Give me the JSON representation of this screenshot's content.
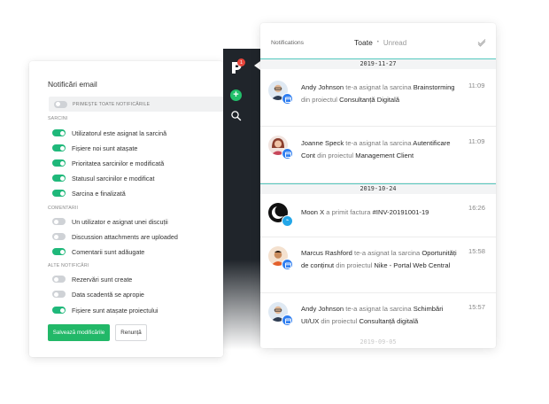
{
  "email_settings": {
    "title": "Notificări email",
    "master_toggle_label": "PRIMEȘTE TOATE NOTIFICĂRILE",
    "sections": [
      {
        "label": "SARCINI",
        "items": [
          {
            "label": "Utilizatorul este asignat la sarcină",
            "on": true
          },
          {
            "label": "Fișiere noi sunt atașate",
            "on": true
          },
          {
            "label": "Prioritatea sarcinilor e modificată",
            "on": true
          },
          {
            "label": "Statusul sarcinilor e modificat",
            "on": true
          },
          {
            "label": "Sarcina e finalizată",
            "on": true
          }
        ]
      },
      {
        "label": "COMENTARII",
        "items": [
          {
            "label": "Un utilizator e asignat unei discuții",
            "on": false
          },
          {
            "label": "Discussion attachments are uploaded",
            "on": false
          },
          {
            "label": "Comentarii sunt adăugate",
            "on": true
          }
        ]
      },
      {
        "label": "ALTE NOTIFICĂRI",
        "items": [
          {
            "label": "Rezervări sunt create",
            "on": false
          },
          {
            "label": "Data scadentă se apropie",
            "on": false
          },
          {
            "label": "Fișiere sunt atașate proiectului",
            "on": true
          }
        ]
      }
    ],
    "save_label": "Salvează modificările",
    "cancel_label": "Renunță"
  },
  "sidebar": {
    "badge_count": "1",
    "logo_color": "#ffffff",
    "add_icon": "plus-icon",
    "search_icon": "search-icon"
  },
  "notifications": {
    "title": "Notifications",
    "tab_all": "Toate",
    "tab_separator": "•",
    "tab_unread": "Unread",
    "mark_read_icon": "double-check-icon",
    "dates": [
      "2019-11-27",
      "2019-10-24",
      "2019-09-05"
    ],
    "items": [
      {
        "name": "Andy Johnson",
        "action": "te-a asignat la sarcina",
        "object": "Brainstorming",
        "connector": "din proiectul",
        "project": "Consultanță Digitală",
        "time": "11:09",
        "badge": "calendar-icon"
      },
      {
        "name": "Joanne Speck",
        "action": "te-a asignat la sarcina",
        "object": "Autentificare Cont",
        "connector": "din proiectul",
        "project": "Management Client",
        "time": "11:09",
        "badge": "calendar-icon"
      },
      {
        "name": "Moon X",
        "action": "a primit factura",
        "object": "#INV-20191001-19",
        "connector": "",
        "project": "",
        "time": "16:26",
        "badge": "invoice-icon"
      },
      {
        "name": "Marcus Rashford",
        "action": "te-a asignat la sarcina",
        "object": "Oportunități de conținut",
        "connector": "din proiectul",
        "project": "Nike - Portal Web Central",
        "time": "15:58",
        "badge": "calendar-icon"
      },
      {
        "name": "Andy Johnson",
        "action": "te-a asignat la sarcina",
        "object": "Schimbări UI/UX",
        "connector": "din proiectul",
        "project": "Consultanță digitală",
        "time": "15:57",
        "badge": "calendar-icon"
      }
    ]
  },
  "colors": {
    "accent_green": "#22b868",
    "toggle_on": "#1fb87a",
    "badge_blue": "#2f7ef0",
    "divider_teal": "#54c8be",
    "sidebar_dark": "#20252b",
    "notification_red": "#e8463c"
  }
}
